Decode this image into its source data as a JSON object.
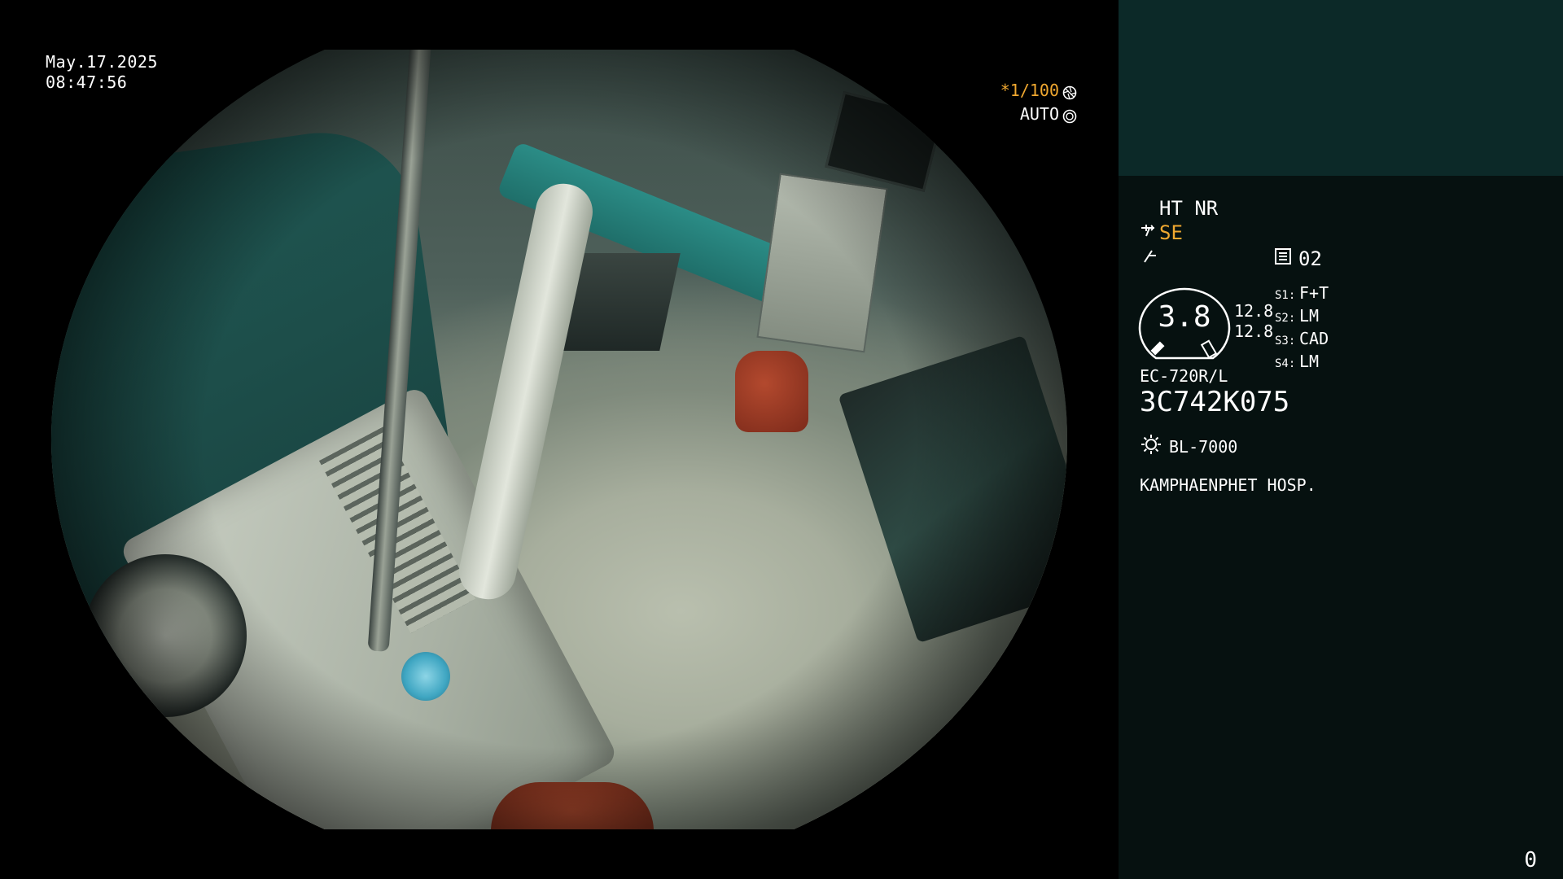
{
  "overlay": {
    "date": "May.17.2025",
    "time": "08:47:56",
    "shutter": "*1/100",
    "shutter_icon": "aperture-icon",
    "iris": "AUTO",
    "iris_icon": "iris-icon"
  },
  "panel": {
    "modes": "HT NR",
    "structure_icon": "structure-enhancement-icon",
    "structure_mode": "SE",
    "enhancement_icon": "enhancement-icon",
    "preset_icon": "preset-icon",
    "preset": "02",
    "gauge_value": "3.8",
    "gauge_side_1": "12.8",
    "gauge_side_2": "12.8",
    "switches": [
      {
        "key": "S1:",
        "value": "F+T"
      },
      {
        "key": "S2:",
        "value": "LM"
      },
      {
        "key": "S3:",
        "value": "CAD"
      },
      {
        "key": "S4:",
        "value": "LM"
      }
    ],
    "scope_model": "EC-720R/L",
    "scope_serial": "3C742K075",
    "light_source_icon": "lamp-icon",
    "light_source": "BL-7000",
    "hospital": "KAMPHAENPHET HOSP.",
    "counter": "0"
  },
  "colors": {
    "accent": "#f0a830",
    "panel_bg": "#061110",
    "panel_top": "#0c2928"
  }
}
